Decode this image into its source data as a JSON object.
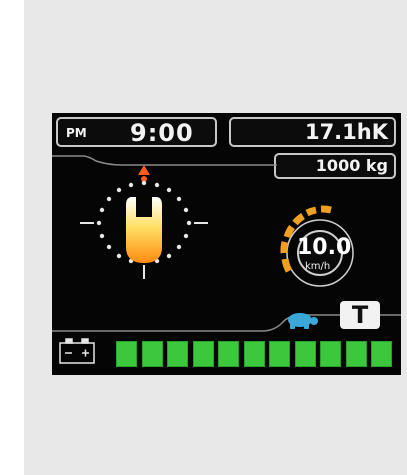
{
  "status_bar": {
    "ampm": "PM",
    "time": "9:00",
    "hour_meter": "17.1hK",
    "load": "1000 kg"
  },
  "speedometer": {
    "value": "10.0",
    "unit": "km/h"
  },
  "mode": {
    "travel_icon": "turtle-icon",
    "t_label": "T"
  },
  "battery": {
    "icon": "battery-icon",
    "segments_lit": 11,
    "segments_total": 11,
    "color": "#3cc83c"
  },
  "colors": {
    "screen_bg": "#050505",
    "accent_orange": "#f0a020",
    "turtle_blue": "#3aa8d8",
    "battery_green": "#3cc83c"
  }
}
